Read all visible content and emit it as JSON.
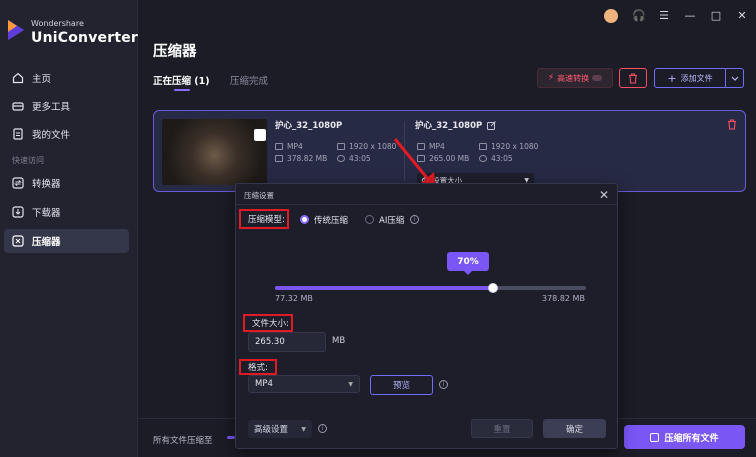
{
  "app": {
    "brand_small": "Wondershare",
    "brand_big": "UniConverter"
  },
  "sidebar": {
    "items": [
      {
        "label": "主页",
        "icon": "home-icon"
      },
      {
        "label": "更多工具",
        "icon": "toolbox-icon"
      },
      {
        "label": "我的文件",
        "icon": "file-icon"
      }
    ],
    "quick_access": "快速访问",
    "quick_items": [
      {
        "label": "转换器",
        "icon": "converter-icon"
      },
      {
        "label": "下载器",
        "icon": "download-icon"
      },
      {
        "label": "压缩器",
        "icon": "compressor-icon",
        "active": true
      }
    ]
  },
  "header": {
    "title": "压缩器",
    "tabs": [
      {
        "label": "正在压缩 (1)",
        "active": true
      },
      {
        "label": "压缩完成"
      }
    ],
    "speed_button": "高速转换",
    "add_file_button": "添加文件"
  },
  "file": {
    "source": {
      "name": "护心_32_1080P",
      "format": "MP4",
      "resolution": "1920 x 1080",
      "size": "378.82 MB",
      "duration": "43:05"
    },
    "target": {
      "name": "护心_32_1080P",
      "format": "MP4",
      "resolution": "1920 x 1080",
      "size": "265.00 MB",
      "duration": "43:05"
    },
    "set_size_button": "设置大小"
  },
  "dialog": {
    "title": "压缩设置",
    "mode_label": "压缩模型:",
    "mode_options": [
      {
        "label": "传统压缩",
        "selected": true
      },
      {
        "label": "AI压缩",
        "selected": false
      }
    ],
    "ratio_percent": 70,
    "ratio_label": "70%",
    "min_label": "77.32 MB",
    "max_label": "378.82 MB",
    "file_size_label": "文件大小:",
    "file_size_value": "265.30",
    "file_size_unit": "MB",
    "format_label": "格式:",
    "format_value": "MP4",
    "preview_button": "预览",
    "advanced_button": "高级设置",
    "reset_button": "重置",
    "ok_button": "确定"
  },
  "footer": {
    "status_text": "所有文件压缩至",
    "compress_all_button": "压缩所有文件"
  },
  "colors": {
    "accent": "#7a56f5",
    "danger": "#ff4d62",
    "highlight_box": "#e01b24"
  }
}
